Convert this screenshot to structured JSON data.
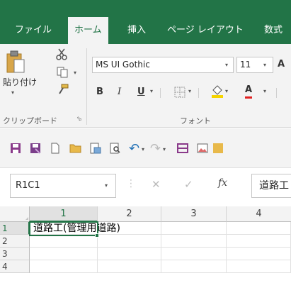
{
  "ribbon_tabs": [
    {
      "label": "ファイル"
    },
    {
      "label": "ホーム"
    },
    {
      "label": "挿入"
    },
    {
      "label": "ページ レイアウト"
    },
    {
      "label": "数式"
    }
  ],
  "active_tab": "ホーム",
  "clipboard": {
    "paste_label": "貼り付け",
    "group_label": "クリップボード"
  },
  "font": {
    "font_name": "MS UI Gothic",
    "font_size": "11",
    "bold": "B",
    "italic": "I",
    "underline": "U",
    "font_color_glyph": "A",
    "grow_glyph": "A",
    "group_label": "フォント"
  },
  "formula_bar": {
    "name_box": "R1C1",
    "fx": "fx",
    "content": "道路工"
  },
  "grid": {
    "column_headers": [
      "1",
      "2",
      "3",
      "4"
    ],
    "row_headers": [
      "1",
      "2",
      "3",
      "4"
    ],
    "cell_r1c1": "道路工(管理用道路)"
  },
  "colors": {
    "accent": "#227447",
    "ribbon_bg": "#f3f3f3",
    "selection": "#217346"
  }
}
